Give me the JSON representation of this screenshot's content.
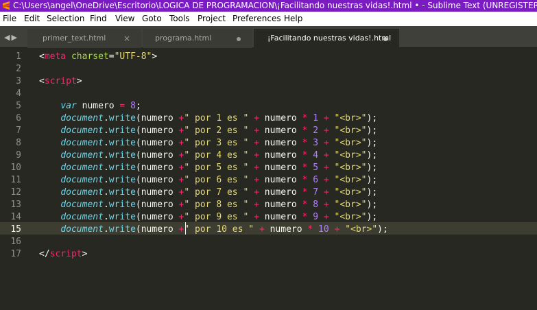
{
  "window": {
    "title": "C:\\Users\\angel\\OneDrive\\Escritorio\\LOGICA DE PROGRAMACION\\¡Facilitando nuestras vidas!.html • - Sublime Text (UNREGISTERED)",
    "accent_color": "#7a1cc2"
  },
  "menu": {
    "items": [
      "File",
      "Edit",
      "Selection",
      "Find",
      "View",
      "Goto",
      "Tools",
      "Project",
      "Preferences",
      "Help"
    ]
  },
  "tabs": [
    {
      "label": "primer_text.html",
      "indicator": "close-icon",
      "close_glyph": "×"
    },
    {
      "label": "programa.html",
      "indicator": "dirty-dot"
    },
    {
      "label": "¡Facilitando nuestras vidas!.html",
      "indicator": "dirty-dot",
      "active": true
    }
  ],
  "nav": {
    "back": "◀",
    "forward": "▶"
  },
  "editor": {
    "current_line": 15,
    "line_numbers": [
      "1",
      "2",
      "3",
      "4",
      "5",
      "6",
      "7",
      "8",
      "9",
      "10",
      "11",
      "12",
      "13",
      "14",
      "15",
      "16",
      "17"
    ],
    "lines": [
      [
        [
          "t-plain",
          "<"
        ],
        [
          "t-tag",
          "meta"
        ],
        [
          "t-plain",
          " "
        ],
        [
          "t-attr",
          "charset"
        ],
        [
          "t-plain",
          "="
        ],
        [
          "t-str",
          "\"UTF-8\""
        ],
        [
          "t-plain",
          ">"
        ]
      ],
      [],
      [
        [
          "t-plain",
          "<"
        ],
        [
          "t-tag",
          "script"
        ],
        [
          "t-plain",
          ">"
        ]
      ],
      [],
      [
        [
          "t-plain",
          "    "
        ],
        [
          "t-kw",
          "var"
        ],
        [
          "t-plain",
          " numero "
        ],
        [
          "t-op",
          "="
        ],
        [
          "t-plain",
          " "
        ],
        [
          "t-num",
          "8"
        ],
        [
          "t-plain",
          ";"
        ]
      ],
      [
        [
          "t-plain",
          "    "
        ],
        [
          "t-obj",
          "document"
        ],
        [
          "t-plain",
          "."
        ],
        [
          "t-fn",
          "write"
        ],
        [
          "t-plain",
          "(numero "
        ],
        [
          "t-op",
          "+"
        ],
        [
          "t-str",
          "\" por 1 es \""
        ],
        [
          "t-plain",
          " "
        ],
        [
          "t-op",
          "+"
        ],
        [
          "t-plain",
          " numero "
        ],
        [
          "t-op",
          "*"
        ],
        [
          "t-plain",
          " "
        ],
        [
          "t-num",
          "1"
        ],
        [
          "t-plain",
          " "
        ],
        [
          "t-op",
          "+"
        ],
        [
          "t-plain",
          " "
        ],
        [
          "t-str",
          "\"<br>\""
        ],
        [
          "t-plain",
          ");"
        ]
      ],
      [
        [
          "t-plain",
          "    "
        ],
        [
          "t-obj",
          "document"
        ],
        [
          "t-plain",
          "."
        ],
        [
          "t-fn",
          "write"
        ],
        [
          "t-plain",
          "(numero "
        ],
        [
          "t-op",
          "+"
        ],
        [
          "t-str",
          "\" por 2 es \""
        ],
        [
          "t-plain",
          " "
        ],
        [
          "t-op",
          "+"
        ],
        [
          "t-plain",
          " numero "
        ],
        [
          "t-op",
          "*"
        ],
        [
          "t-plain",
          " "
        ],
        [
          "t-num",
          "2"
        ],
        [
          "t-plain",
          " "
        ],
        [
          "t-op",
          "+"
        ],
        [
          "t-plain",
          " "
        ],
        [
          "t-str",
          "\"<br>\""
        ],
        [
          "t-plain",
          ");"
        ]
      ],
      [
        [
          "t-plain",
          "    "
        ],
        [
          "t-obj",
          "document"
        ],
        [
          "t-plain",
          "."
        ],
        [
          "t-fn",
          "write"
        ],
        [
          "t-plain",
          "(numero "
        ],
        [
          "t-op",
          "+"
        ],
        [
          "t-str",
          "\" por 3 es \""
        ],
        [
          "t-plain",
          " "
        ],
        [
          "t-op",
          "+"
        ],
        [
          "t-plain",
          " numero "
        ],
        [
          "t-op",
          "*"
        ],
        [
          "t-plain",
          " "
        ],
        [
          "t-num",
          "3"
        ],
        [
          "t-plain",
          " "
        ],
        [
          "t-op",
          "+"
        ],
        [
          "t-plain",
          " "
        ],
        [
          "t-str",
          "\"<br>\""
        ],
        [
          "t-plain",
          ");"
        ]
      ],
      [
        [
          "t-plain",
          "    "
        ],
        [
          "t-obj",
          "document"
        ],
        [
          "t-plain",
          "."
        ],
        [
          "t-fn",
          "write"
        ],
        [
          "t-plain",
          "(numero "
        ],
        [
          "t-op",
          "+"
        ],
        [
          "t-str",
          "\" por 4 es \""
        ],
        [
          "t-plain",
          " "
        ],
        [
          "t-op",
          "+"
        ],
        [
          "t-plain",
          " numero "
        ],
        [
          "t-op",
          "*"
        ],
        [
          "t-plain",
          " "
        ],
        [
          "t-num",
          "4"
        ],
        [
          "t-plain",
          " "
        ],
        [
          "t-op",
          "+"
        ],
        [
          "t-plain",
          " "
        ],
        [
          "t-str",
          "\"<br>\""
        ],
        [
          "t-plain",
          ");"
        ]
      ],
      [
        [
          "t-plain",
          "    "
        ],
        [
          "t-obj",
          "document"
        ],
        [
          "t-plain",
          "."
        ],
        [
          "t-fn",
          "write"
        ],
        [
          "t-plain",
          "(numero "
        ],
        [
          "t-op",
          "+"
        ],
        [
          "t-str",
          "\" por 5 es \""
        ],
        [
          "t-plain",
          " "
        ],
        [
          "t-op",
          "+"
        ],
        [
          "t-plain",
          " numero "
        ],
        [
          "t-op",
          "*"
        ],
        [
          "t-plain",
          " "
        ],
        [
          "t-num",
          "5"
        ],
        [
          "t-plain",
          " "
        ],
        [
          "t-op",
          "+"
        ],
        [
          "t-plain",
          " "
        ],
        [
          "t-str",
          "\"<br>\""
        ],
        [
          "t-plain",
          ");"
        ]
      ],
      [
        [
          "t-plain",
          "    "
        ],
        [
          "t-obj",
          "document"
        ],
        [
          "t-plain",
          "."
        ],
        [
          "t-fn",
          "write"
        ],
        [
          "t-plain",
          "(numero "
        ],
        [
          "t-op",
          "+"
        ],
        [
          "t-str",
          "\" por 6 es \""
        ],
        [
          "t-plain",
          " "
        ],
        [
          "t-op",
          "+"
        ],
        [
          "t-plain",
          " numero "
        ],
        [
          "t-op",
          "*"
        ],
        [
          "t-plain",
          " "
        ],
        [
          "t-num",
          "6"
        ],
        [
          "t-plain",
          " "
        ],
        [
          "t-op",
          "+"
        ],
        [
          "t-plain",
          " "
        ],
        [
          "t-str",
          "\"<br>\""
        ],
        [
          "t-plain",
          ");"
        ]
      ],
      [
        [
          "t-plain",
          "    "
        ],
        [
          "t-obj",
          "document"
        ],
        [
          "t-plain",
          "."
        ],
        [
          "t-fn",
          "write"
        ],
        [
          "t-plain",
          "(numero "
        ],
        [
          "t-op",
          "+"
        ],
        [
          "t-str",
          "\" por 7 es \""
        ],
        [
          "t-plain",
          " "
        ],
        [
          "t-op",
          "+"
        ],
        [
          "t-plain",
          " numero "
        ],
        [
          "t-op",
          "*"
        ],
        [
          "t-plain",
          " "
        ],
        [
          "t-num",
          "7"
        ],
        [
          "t-plain",
          " "
        ],
        [
          "t-op",
          "+"
        ],
        [
          "t-plain",
          " "
        ],
        [
          "t-str",
          "\"<br>\""
        ],
        [
          "t-plain",
          ");"
        ]
      ],
      [
        [
          "t-plain",
          "    "
        ],
        [
          "t-obj",
          "document"
        ],
        [
          "t-plain",
          "."
        ],
        [
          "t-fn",
          "write"
        ],
        [
          "t-plain",
          "(numero "
        ],
        [
          "t-op",
          "+"
        ],
        [
          "t-str",
          "\" por 8 es \""
        ],
        [
          "t-plain",
          " "
        ],
        [
          "t-op",
          "+"
        ],
        [
          "t-plain",
          " numero "
        ],
        [
          "t-op",
          "*"
        ],
        [
          "t-plain",
          " "
        ],
        [
          "t-num",
          "8"
        ],
        [
          "t-plain",
          " "
        ],
        [
          "t-op",
          "+"
        ],
        [
          "t-plain",
          " "
        ],
        [
          "t-str",
          "\"<br>\""
        ],
        [
          "t-plain",
          ");"
        ]
      ],
      [
        [
          "t-plain",
          "    "
        ],
        [
          "t-obj",
          "document"
        ],
        [
          "t-plain",
          "."
        ],
        [
          "t-fn",
          "write"
        ],
        [
          "t-plain",
          "(numero "
        ],
        [
          "t-op",
          "+"
        ],
        [
          "t-str",
          "\" por 9 es \""
        ],
        [
          "t-plain",
          " "
        ],
        [
          "t-op",
          "+"
        ],
        [
          "t-plain",
          " numero "
        ],
        [
          "t-op",
          "*"
        ],
        [
          "t-plain",
          " "
        ],
        [
          "t-num",
          "9"
        ],
        [
          "t-plain",
          " "
        ],
        [
          "t-op",
          "+"
        ],
        [
          "t-plain",
          " "
        ],
        [
          "t-str",
          "\"<br>\""
        ],
        [
          "t-plain",
          ");"
        ]
      ],
      [
        [
          "t-plain",
          "    "
        ],
        [
          "t-obj",
          "document"
        ],
        [
          "t-plain",
          "."
        ],
        [
          "t-fn",
          "write"
        ],
        [
          "t-plain",
          "(numero "
        ],
        [
          "t-op",
          "+"
        ],
        [
          "t-str",
          "\" por 10 es \""
        ],
        [
          "t-plain",
          " "
        ],
        [
          "t-op",
          "+"
        ],
        [
          "t-plain",
          " numero "
        ],
        [
          "t-op",
          "*"
        ],
        [
          "t-plain",
          " "
        ],
        [
          "t-num",
          "10"
        ],
        [
          "t-plain",
          " "
        ],
        [
          "t-op",
          "+"
        ],
        [
          "t-plain",
          " "
        ],
        [
          "t-str",
          "\"<br>\""
        ],
        [
          "t-plain",
          ");"
        ]
      ],
      [],
      [
        [
          "t-plain",
          "</"
        ],
        [
          "t-tag",
          "script"
        ],
        [
          "t-plain",
          ">"
        ]
      ]
    ]
  }
}
